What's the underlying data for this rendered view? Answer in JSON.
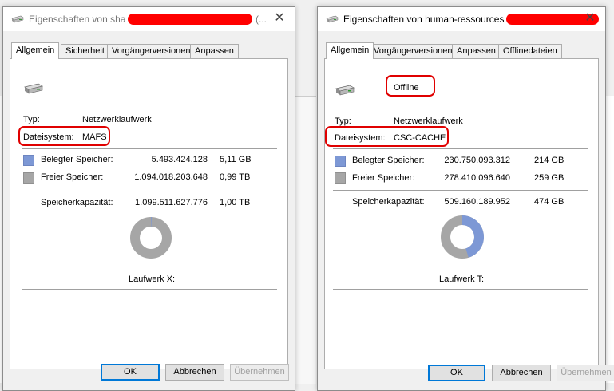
{
  "left": {
    "title": "Eigenschaften von sha",
    "title_suffix": "(...",
    "tabs": [
      "Allgemein",
      "Sicherheit",
      "Vorgängerversionen",
      "Anpassen"
    ],
    "type_label": "Typ:",
    "type_value": "Netzwerklaufwerk",
    "fs_label": "Dateisystem:",
    "fs_value": "MAFS",
    "used_label": "Belegter Speicher:",
    "used_bytes": "5.493.424.128",
    "used_size": "5,11 GB",
    "free_label": "Freier Speicher:",
    "free_bytes": "1.094.018.203.648",
    "free_size": "0,99 TB",
    "cap_label": "Speicherkapazität:",
    "cap_bytes": "1.099.511.627.776",
    "cap_size": "1,00 TB",
    "drive_label": "Laufwerk X:",
    "used_fraction": 0.005,
    "ok": "OK",
    "cancel": "Abbrechen",
    "apply": "Übernehmen"
  },
  "right": {
    "title": "Eigenschaften von human-ressources (",
    "tabs": [
      "Allgemein",
      "Vorgängerversionen",
      "Anpassen",
      "Offlinedateien"
    ],
    "status": "Offline",
    "type_label": "Typ:",
    "type_value": "Netzwerklaufwerk",
    "fs_label": "Dateisystem:",
    "fs_value": "CSC-CACHE",
    "used_label": "Belegter Speicher:",
    "used_bytes": "230.750.093.312",
    "used_size": "214 GB",
    "free_label": "Freier Speicher:",
    "free_bytes": "278.410.096.640",
    "free_size": "259 GB",
    "cap_label": "Speicherkapazität:",
    "cap_bytes": "509.160.189.952",
    "cap_size": "474 GB",
    "drive_label": "Laufwerk T:",
    "used_fraction": 0.453,
    "ok": "OK",
    "cancel": "Abbrechen",
    "apply": "Übernehmen"
  },
  "colors": {
    "used": "#7d98d5",
    "free": "#a6a6a6",
    "annotation": "#e00000"
  }
}
